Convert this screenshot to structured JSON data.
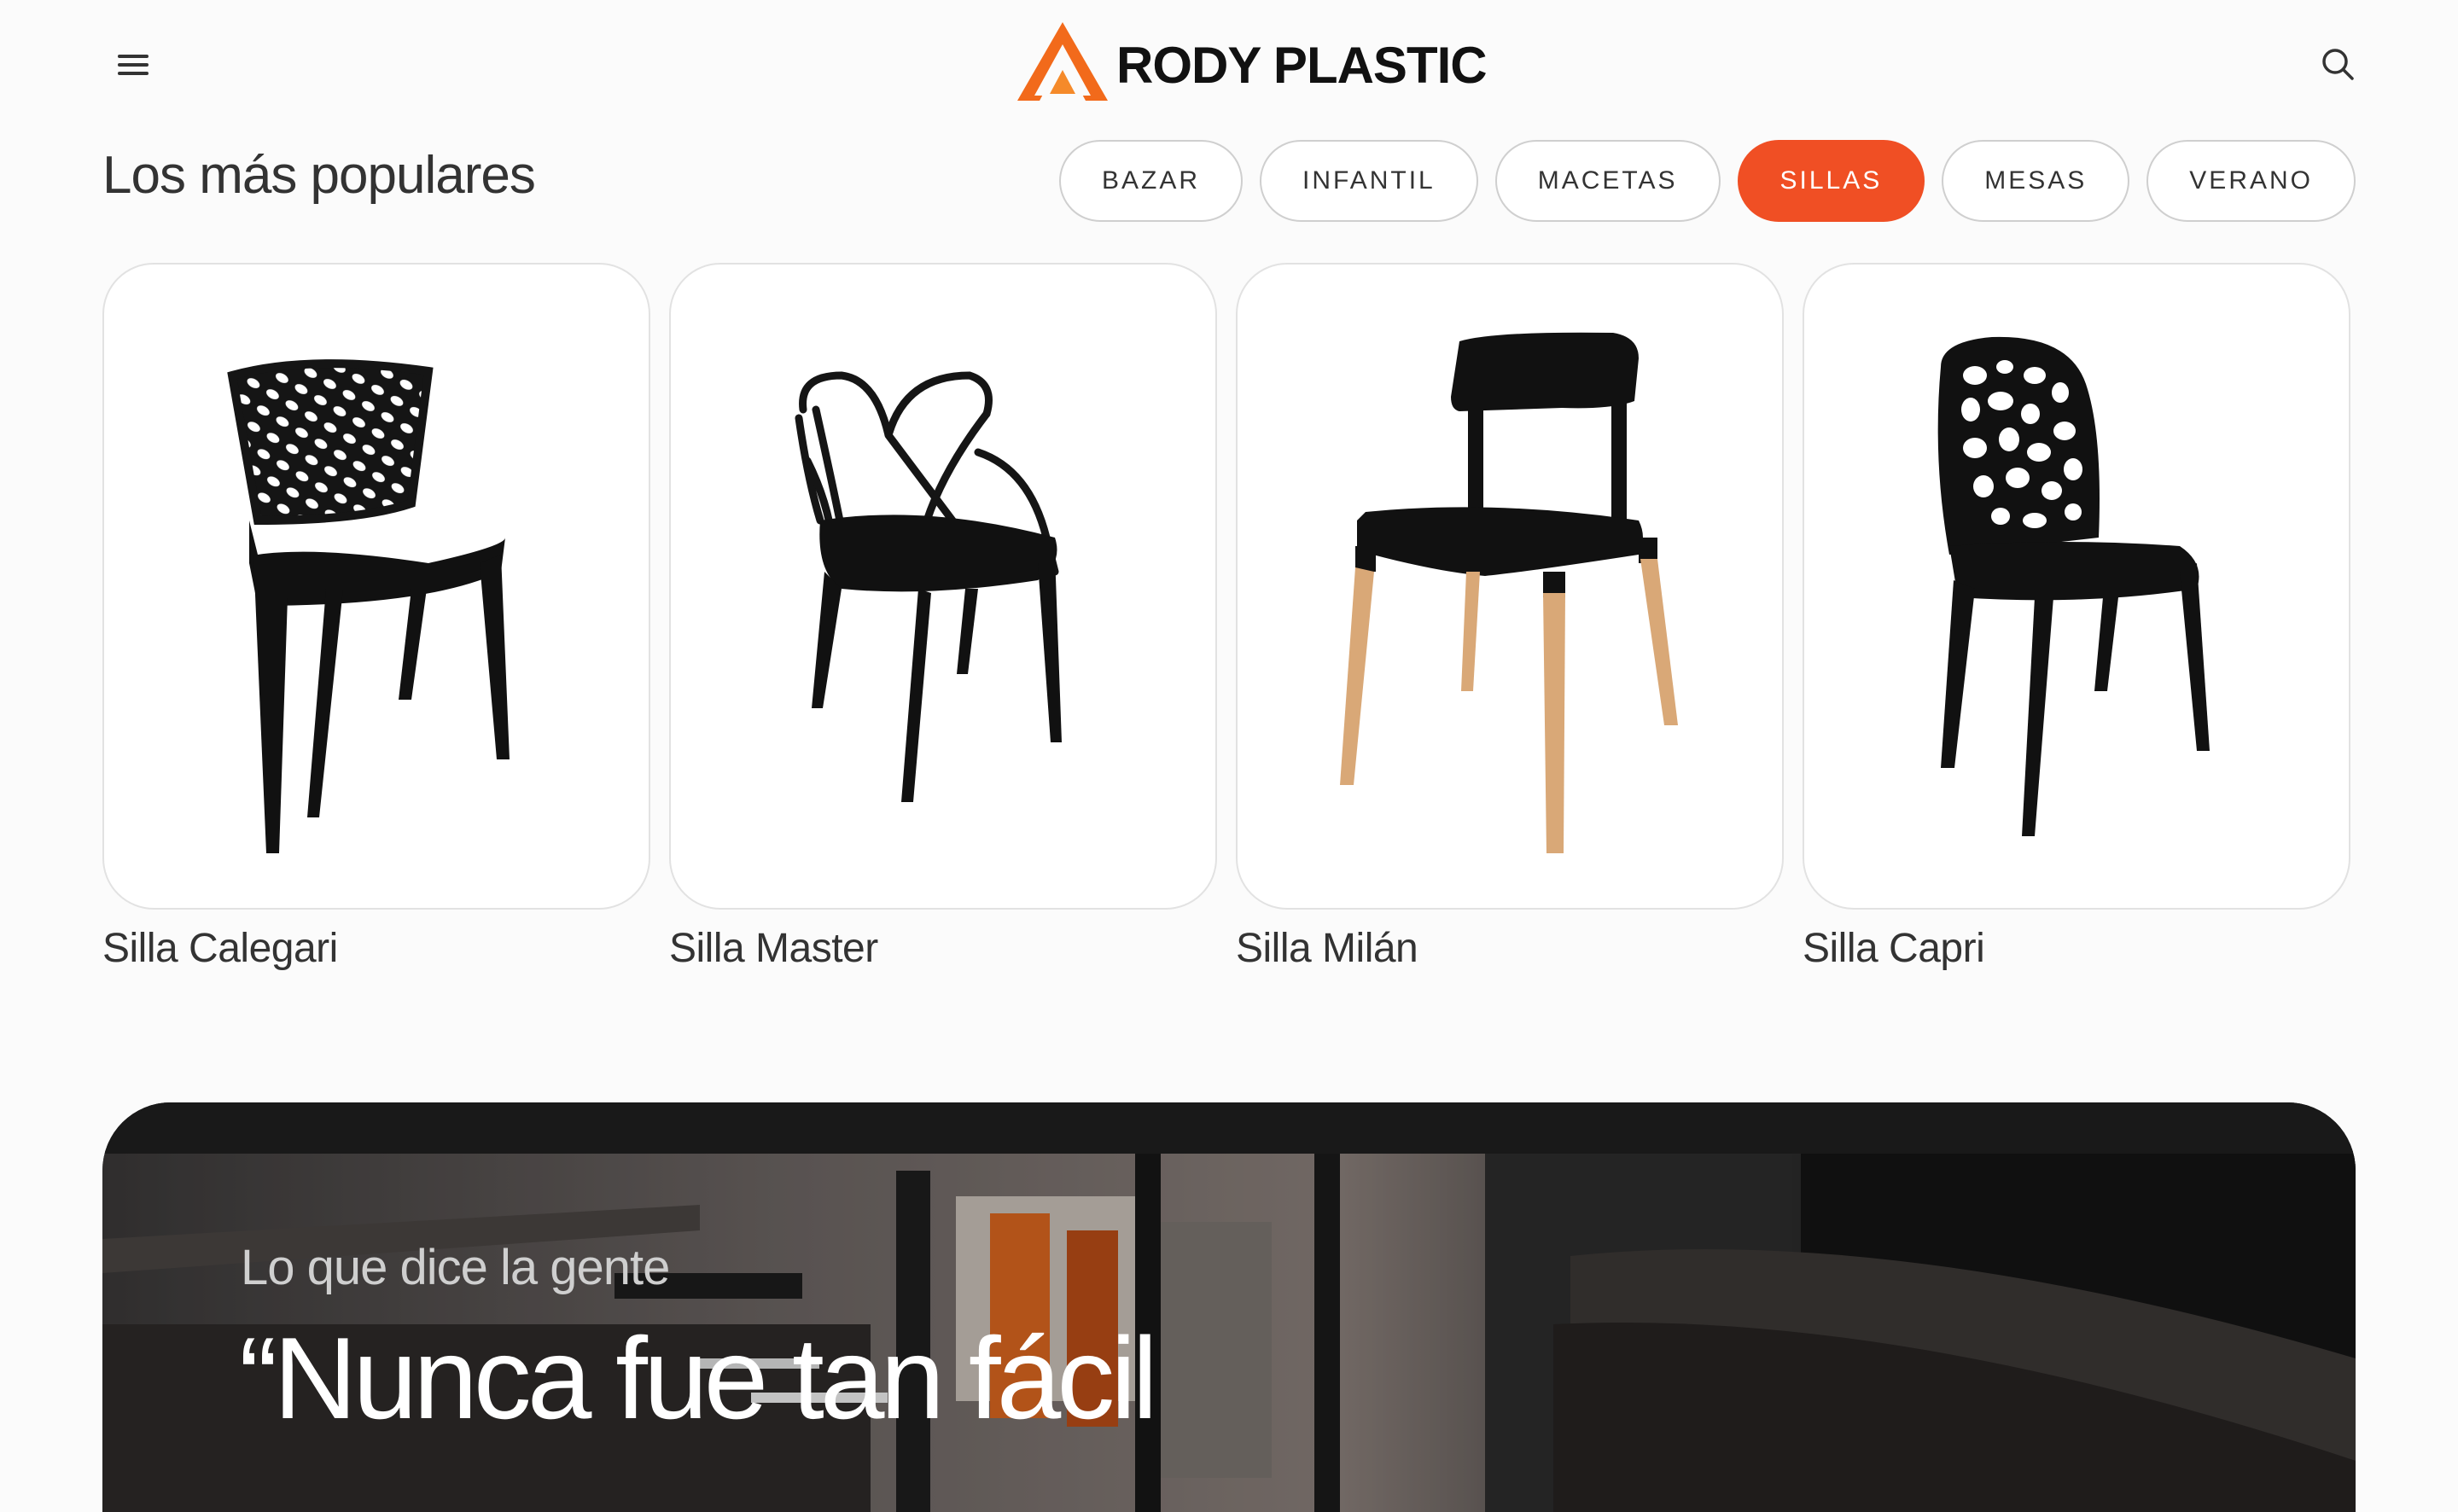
{
  "header": {
    "brand": "RODY PLASTIC",
    "menu_icon": "hamburger-menu-icon",
    "search_icon": "search-icon",
    "brand_colors": {
      "orange": "#f26a1b",
      "dark": "#111111"
    }
  },
  "popular": {
    "title": "Los más populares",
    "categories": [
      {
        "label": "BAZAR",
        "active": false
      },
      {
        "label": "INFANTIL",
        "active": false
      },
      {
        "label": "MACETAS",
        "active": false
      },
      {
        "label": "SILLAS",
        "active": true
      },
      {
        "label": "MESAS",
        "active": false
      },
      {
        "label": "VERANO",
        "active": false
      }
    ],
    "active_color": "#f04f24",
    "products": [
      {
        "name": "Silla Calegari"
      },
      {
        "name": "Silla Master"
      },
      {
        "name": "Silla Milán"
      },
      {
        "name": "Silla Capri"
      }
    ]
  },
  "testimonial": {
    "kicker": "Lo que dice la gente",
    "quote_start": "“Nunca fue tan fácil"
  }
}
